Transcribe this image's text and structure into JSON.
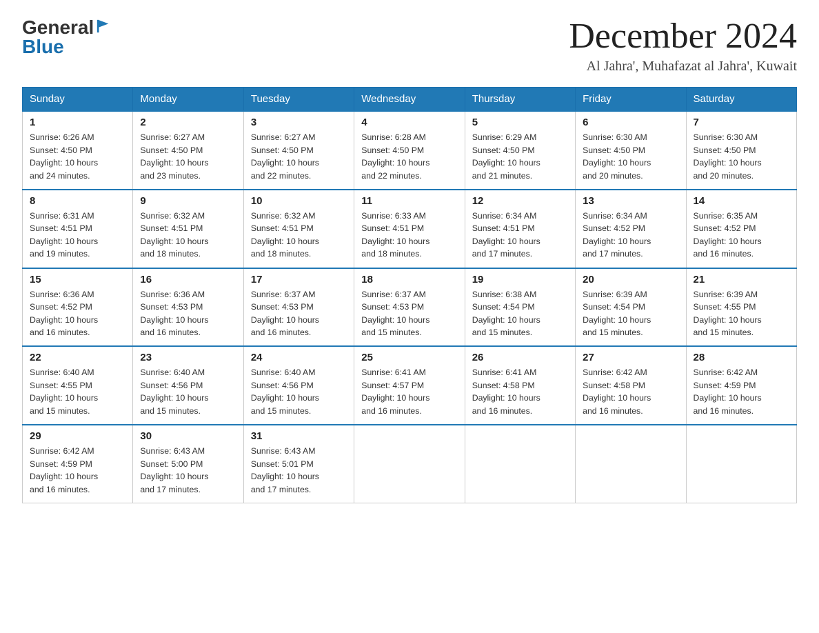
{
  "header": {
    "logo_general": "General",
    "logo_blue": "Blue",
    "month_title": "December 2024",
    "subtitle": "Al Jahra', Muhafazat al Jahra', Kuwait"
  },
  "weekdays": [
    "Sunday",
    "Monday",
    "Tuesday",
    "Wednesday",
    "Thursday",
    "Friday",
    "Saturday"
  ],
  "weeks": [
    [
      {
        "day": "1",
        "sunrise": "6:26 AM",
        "sunset": "4:50 PM",
        "daylight": "10 hours and 24 minutes."
      },
      {
        "day": "2",
        "sunrise": "6:27 AM",
        "sunset": "4:50 PM",
        "daylight": "10 hours and 23 minutes."
      },
      {
        "day": "3",
        "sunrise": "6:27 AM",
        "sunset": "4:50 PM",
        "daylight": "10 hours and 22 minutes."
      },
      {
        "day": "4",
        "sunrise": "6:28 AM",
        "sunset": "4:50 PM",
        "daylight": "10 hours and 22 minutes."
      },
      {
        "day": "5",
        "sunrise": "6:29 AM",
        "sunset": "4:50 PM",
        "daylight": "10 hours and 21 minutes."
      },
      {
        "day": "6",
        "sunrise": "6:30 AM",
        "sunset": "4:50 PM",
        "daylight": "10 hours and 20 minutes."
      },
      {
        "day": "7",
        "sunrise": "6:30 AM",
        "sunset": "4:50 PM",
        "daylight": "10 hours and 20 minutes."
      }
    ],
    [
      {
        "day": "8",
        "sunrise": "6:31 AM",
        "sunset": "4:51 PM",
        "daylight": "10 hours and 19 minutes."
      },
      {
        "day": "9",
        "sunrise": "6:32 AM",
        "sunset": "4:51 PM",
        "daylight": "10 hours and 18 minutes."
      },
      {
        "day": "10",
        "sunrise": "6:32 AM",
        "sunset": "4:51 PM",
        "daylight": "10 hours and 18 minutes."
      },
      {
        "day": "11",
        "sunrise": "6:33 AM",
        "sunset": "4:51 PM",
        "daylight": "10 hours and 18 minutes."
      },
      {
        "day": "12",
        "sunrise": "6:34 AM",
        "sunset": "4:51 PM",
        "daylight": "10 hours and 17 minutes."
      },
      {
        "day": "13",
        "sunrise": "6:34 AM",
        "sunset": "4:52 PM",
        "daylight": "10 hours and 17 minutes."
      },
      {
        "day": "14",
        "sunrise": "6:35 AM",
        "sunset": "4:52 PM",
        "daylight": "10 hours and 16 minutes."
      }
    ],
    [
      {
        "day": "15",
        "sunrise": "6:36 AM",
        "sunset": "4:52 PM",
        "daylight": "10 hours and 16 minutes."
      },
      {
        "day": "16",
        "sunrise": "6:36 AM",
        "sunset": "4:53 PM",
        "daylight": "10 hours and 16 minutes."
      },
      {
        "day": "17",
        "sunrise": "6:37 AM",
        "sunset": "4:53 PM",
        "daylight": "10 hours and 16 minutes."
      },
      {
        "day": "18",
        "sunrise": "6:37 AM",
        "sunset": "4:53 PM",
        "daylight": "10 hours and 15 minutes."
      },
      {
        "day": "19",
        "sunrise": "6:38 AM",
        "sunset": "4:54 PM",
        "daylight": "10 hours and 15 minutes."
      },
      {
        "day": "20",
        "sunrise": "6:39 AM",
        "sunset": "4:54 PM",
        "daylight": "10 hours and 15 minutes."
      },
      {
        "day": "21",
        "sunrise": "6:39 AM",
        "sunset": "4:55 PM",
        "daylight": "10 hours and 15 minutes."
      }
    ],
    [
      {
        "day": "22",
        "sunrise": "6:40 AM",
        "sunset": "4:55 PM",
        "daylight": "10 hours and 15 minutes."
      },
      {
        "day": "23",
        "sunrise": "6:40 AM",
        "sunset": "4:56 PM",
        "daylight": "10 hours and 15 minutes."
      },
      {
        "day": "24",
        "sunrise": "6:40 AM",
        "sunset": "4:56 PM",
        "daylight": "10 hours and 15 minutes."
      },
      {
        "day": "25",
        "sunrise": "6:41 AM",
        "sunset": "4:57 PM",
        "daylight": "10 hours and 16 minutes."
      },
      {
        "day": "26",
        "sunrise": "6:41 AM",
        "sunset": "4:58 PM",
        "daylight": "10 hours and 16 minutes."
      },
      {
        "day": "27",
        "sunrise": "6:42 AM",
        "sunset": "4:58 PM",
        "daylight": "10 hours and 16 minutes."
      },
      {
        "day": "28",
        "sunrise": "6:42 AM",
        "sunset": "4:59 PM",
        "daylight": "10 hours and 16 minutes."
      }
    ],
    [
      {
        "day": "29",
        "sunrise": "6:42 AM",
        "sunset": "4:59 PM",
        "daylight": "10 hours and 16 minutes."
      },
      {
        "day": "30",
        "sunrise": "6:43 AM",
        "sunset": "5:00 PM",
        "daylight": "10 hours and 17 minutes."
      },
      {
        "day": "31",
        "sunrise": "6:43 AM",
        "sunset": "5:01 PM",
        "daylight": "10 hours and 17 minutes."
      },
      null,
      null,
      null,
      null
    ]
  ],
  "labels": {
    "sunrise": "Sunrise:",
    "sunset": "Sunset:",
    "daylight": "Daylight:"
  }
}
